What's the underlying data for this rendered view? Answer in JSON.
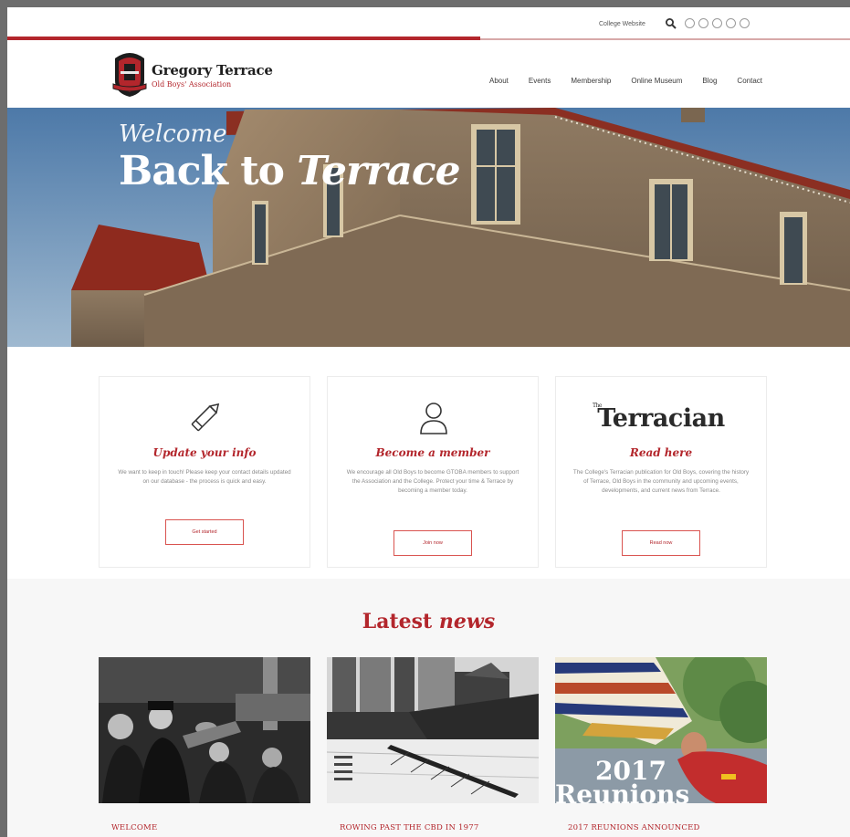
{
  "utility": {
    "college_link": "College Website"
  },
  "brand": {
    "name": "Gregory Terrace",
    "subtitle": "Old Boys' Association"
  },
  "nav": {
    "items": [
      "About",
      "Events",
      "Membership",
      "Online Museum",
      "Blog",
      "Contact"
    ]
  },
  "hero": {
    "line1": "Welcome",
    "line2_a": "Back to ",
    "line2_b": "Terrace"
  },
  "cards": [
    {
      "icon": "pencil-icon",
      "title": "Update your info",
      "body": "We want to keep in touch! Please keep your contact details updated on our database - the process is quick and easy.",
      "button": "Get started"
    },
    {
      "icon": "user-icon",
      "title": "Become a member",
      "body": "We encourage all Old Boys to become GTOBA members to support the Association and the College. Protect your time & Terrace by becoming a member today.",
      "button": "Join now"
    },
    {
      "masthead": "Terracian",
      "masthead_prefix": "The",
      "title": "Read here",
      "body": "The College's Terracian publication for Old Boys, covering the history of Terrace, Old Boys in the community and upcoming events, developments, and current news from Terrace.",
      "button": "Read now"
    }
  ],
  "news": {
    "heading_a": "Latest ",
    "heading_b": "news",
    "items": [
      {
        "title": "WELCOME"
      },
      {
        "title": "ROWING PAST THE CBD IN 1977"
      },
      {
        "title": "2017 REUNIONS ANNOUNCED",
        "image_text_a": "2017",
        "image_text_b": "Reunions"
      }
    ]
  },
  "colors": {
    "accent": "#b3262c",
    "accent_light": "#d7a9a9",
    "section_bg": "#f7f7f7"
  }
}
